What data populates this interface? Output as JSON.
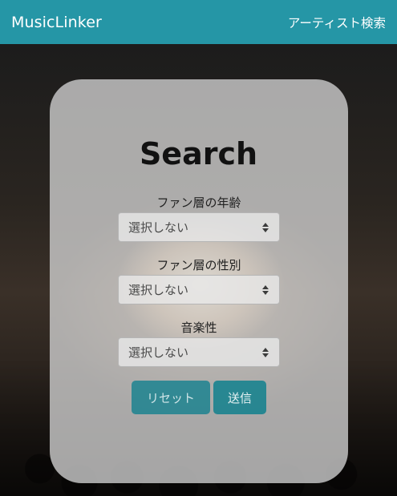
{
  "navbar": {
    "brand": "MusicLinker",
    "link": "アーティスト検索",
    "color": "#2596a6"
  },
  "card": {
    "title": "Search"
  },
  "filters": [
    {
      "label": "ファン層の年齢",
      "selected": "選択しない"
    },
    {
      "label": "ファン層の性別",
      "selected": "選択しない"
    },
    {
      "label": "音楽性",
      "selected": "選択しない"
    }
  ],
  "buttons": {
    "reset": "リセット",
    "submit": "送信",
    "color": "#1f8a96"
  }
}
